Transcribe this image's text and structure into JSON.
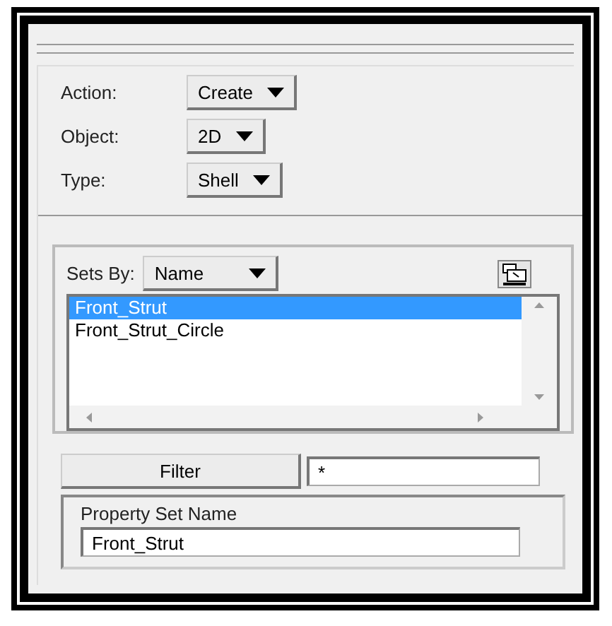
{
  "form": [
    {
      "label": "Action:",
      "value": "Create"
    },
    {
      "label": "Object:",
      "value": "2D"
    },
    {
      "label": "Type:",
      "value": "Shell"
    }
  ],
  "sets": {
    "label": "Sets By:",
    "value": "Name",
    "items": [
      {
        "text": "Front_Strut",
        "selected": true
      },
      {
        "text": "Front_Strut_Circle",
        "selected": false
      }
    ]
  },
  "filter": {
    "button": "Filter",
    "value": "*"
  },
  "property_set": {
    "label": "Property Set Name",
    "value": "Front_Strut"
  }
}
